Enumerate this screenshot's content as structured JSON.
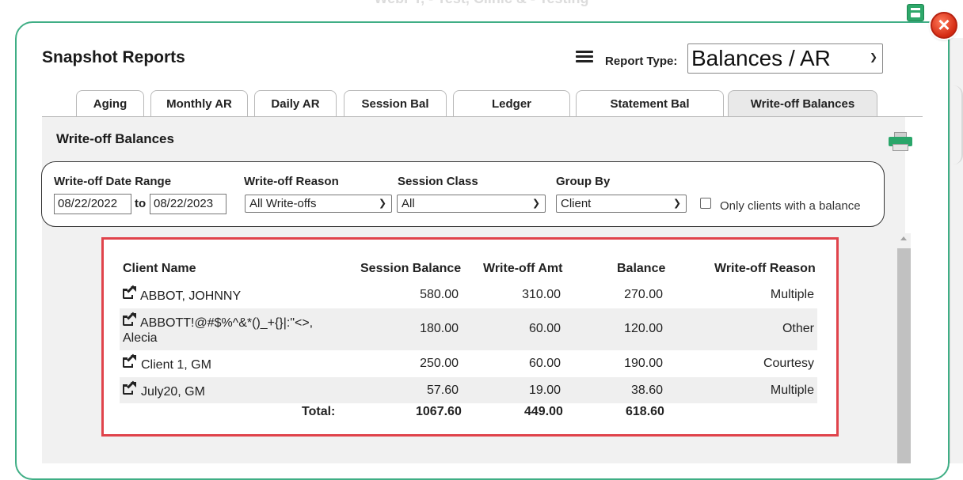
{
  "background_title": "WebPT, - Test, Clinic & - Testing",
  "header": {
    "title": "Snapshot Reports",
    "report_type_label": "Report Type:",
    "report_type_value": "Balances / AR"
  },
  "tabs": [
    {
      "label": "Aging"
    },
    {
      "label": "Monthly AR"
    },
    {
      "label": "Daily AR"
    },
    {
      "label": "Session Bal"
    },
    {
      "label": "Ledger"
    },
    {
      "label": "Statement Bal"
    },
    {
      "label": "Write-off Balances",
      "active": true
    }
  ],
  "section": {
    "title": "Write-off Balances"
  },
  "filters": {
    "date_range_label": "Write-off Date Range",
    "date_from": "08/22/2022",
    "to_label": "to",
    "date_to": "08/22/2023",
    "reason_label": "Write-off Reason",
    "reason_value": "All Write-offs",
    "session_class_label": "Session Class",
    "session_class_value": "All",
    "group_by_label": "Group By",
    "group_by_value": "Client",
    "only_balance_label": "Only clients with a balance",
    "only_balance_checked": false
  },
  "table": {
    "headers": {
      "client": "Client Name",
      "session_balance": "Session Balance",
      "writeoff_amt": "Write-off Amt",
      "balance": "Balance",
      "reason": "Write-off Reason"
    },
    "rows": [
      {
        "client_line1": "ABBOT, JOHNNY",
        "client_line2": "",
        "session_balance": "580.00",
        "writeoff_amt": "310.00",
        "balance": "270.00",
        "reason": "Multiple"
      },
      {
        "client_line1": "ABBOTT!@#$%^&*()_+{}|:\"<>,",
        "client_line2": "Alecia",
        "session_balance": "180.00",
        "writeoff_amt": "60.00",
        "balance": "120.00",
        "reason": "Other"
      },
      {
        "client_line1": "Client 1, GM",
        "client_line2": "",
        "session_balance": "250.00",
        "writeoff_amt": "60.00",
        "balance": "190.00",
        "reason": "Courtesy"
      },
      {
        "client_line1": "July20, GM",
        "client_line2": "",
        "session_balance": "57.60",
        "writeoff_amt": "19.00",
        "balance": "38.60",
        "reason": "Multiple"
      }
    ],
    "total": {
      "label": "Total:",
      "session_balance": "1067.60",
      "writeoff_amt": "449.00",
      "balance": "618.60"
    }
  },
  "colors": {
    "dialog_border": "#3fae85",
    "highlight_border": "#e0434b",
    "close_button": "#d42a12"
  }
}
